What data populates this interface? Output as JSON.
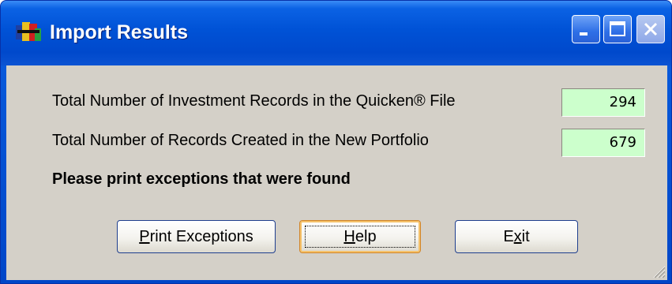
{
  "window": {
    "title": "Import Results",
    "icon": "app-logo-icon"
  },
  "titlebar_buttons": {
    "minimize_icon": "minimize-icon",
    "maximize_icon": "maximize-icon",
    "close_icon": "close-icon"
  },
  "results": {
    "investment_records_label": "Total Number of Investment Records in the Quicken® File",
    "investment_records_value": "294",
    "records_created_label": "Total Number of Records Created in the New Portfolio",
    "records_created_value": "679",
    "note": "Please print exceptions that were found"
  },
  "buttons": {
    "print_mnemonic": "P",
    "print_rest": "rint Exceptions",
    "help_mnemonic": "H",
    "help_rest": "elp",
    "exit_before": "E",
    "exit_mnemonic": "x",
    "exit_after": "it"
  },
  "colors": {
    "titlebar": "#0052d6",
    "client_bg": "#d4d0c8",
    "value_bg": "#ccffcc",
    "focus_border": "#d1852a"
  }
}
